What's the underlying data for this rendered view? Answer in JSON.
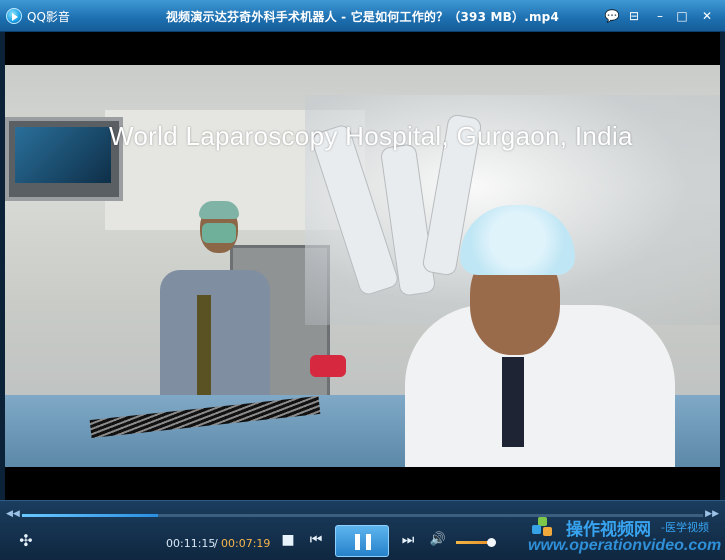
{
  "titlebar": {
    "app_name": "QQ影音",
    "window_title": "视频演示达芬奇外科手术机器人 - 它是如何工作的？（393 MB）.mp4",
    "buttons": [
      {
        "name": "chat-icon",
        "glyph": "💬"
      },
      {
        "name": "playlist-icon",
        "glyph": "⊟"
      },
      {
        "name": "minimize-icon",
        "glyph": "–"
      },
      {
        "name": "maximize-icon",
        "glyph": "□"
      },
      {
        "name": "close-icon",
        "glyph": "✕"
      }
    ]
  },
  "video": {
    "caption": "World Laparoscopy Hospital, Gurgaon, India"
  },
  "controls": {
    "seek_left_glyph": "◀◀",
    "seek_right_glyph": "▶▶",
    "progress": 0.2,
    "time_elapsed": "00:11:15",
    "time_separator": "/",
    "time_remaining": "00:07:19",
    "stop_glyph": "■",
    "prev_glyph": "⏮",
    "next_glyph": "⏭",
    "volume_glyph": "🔊",
    "volume_level": 0.88,
    "left_icon_glyph": "✣"
  },
  "watermark": {
    "text_cn": "操作视频网",
    "text_cn_small": "-医学视频",
    "url": "www.operationvideo.com"
  },
  "colors": {
    "accent": "#2b8fe0",
    "time_remaining": "#f6b44a",
    "titlebar": "#1d6fb0"
  }
}
